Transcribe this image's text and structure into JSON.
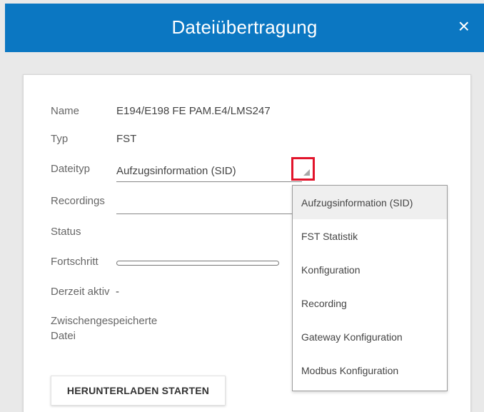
{
  "dialog": {
    "title": "Dateiübertragung",
    "close_symbol": "×"
  },
  "form": {
    "name_label": "Name",
    "name_value": "E194/E198 FE PAM.E4/LMS247",
    "typ_label": "Typ",
    "typ_value": "FST",
    "dateityp_label": "Dateityp",
    "dateityp_value": "Aufzugsinformation (SID)",
    "recordings_label": "Recordings",
    "recordings_value": "",
    "status_label": "Status",
    "status_value": "",
    "fortschritt_label": "Fortschritt",
    "fortschritt_percent": 0,
    "derzeit_label": "Derzeit aktiv",
    "derzeit_value": "-",
    "cache_label_line1": "Zwischengespeicherte",
    "cache_label_line2": "Datei"
  },
  "actions": {
    "start_label": "HERUNTERLADEN STARTEN"
  },
  "dropdown": {
    "icon": "chevron-down-icon",
    "options": [
      {
        "label": "Aufzugsinformation (SID)",
        "selected": true
      },
      {
        "label": "FST Statistik",
        "selected": false
      },
      {
        "label": "Konfiguration",
        "selected": false
      },
      {
        "label": "Recording",
        "selected": false
      },
      {
        "label": "Gateway Konfiguration",
        "selected": false
      },
      {
        "label": "Modbus Konfiguration",
        "selected": false
      }
    ]
  },
  "colors": {
    "header_bg": "#0b77c2",
    "highlight_border": "#e2142b",
    "selected_bg": "#efefef"
  }
}
